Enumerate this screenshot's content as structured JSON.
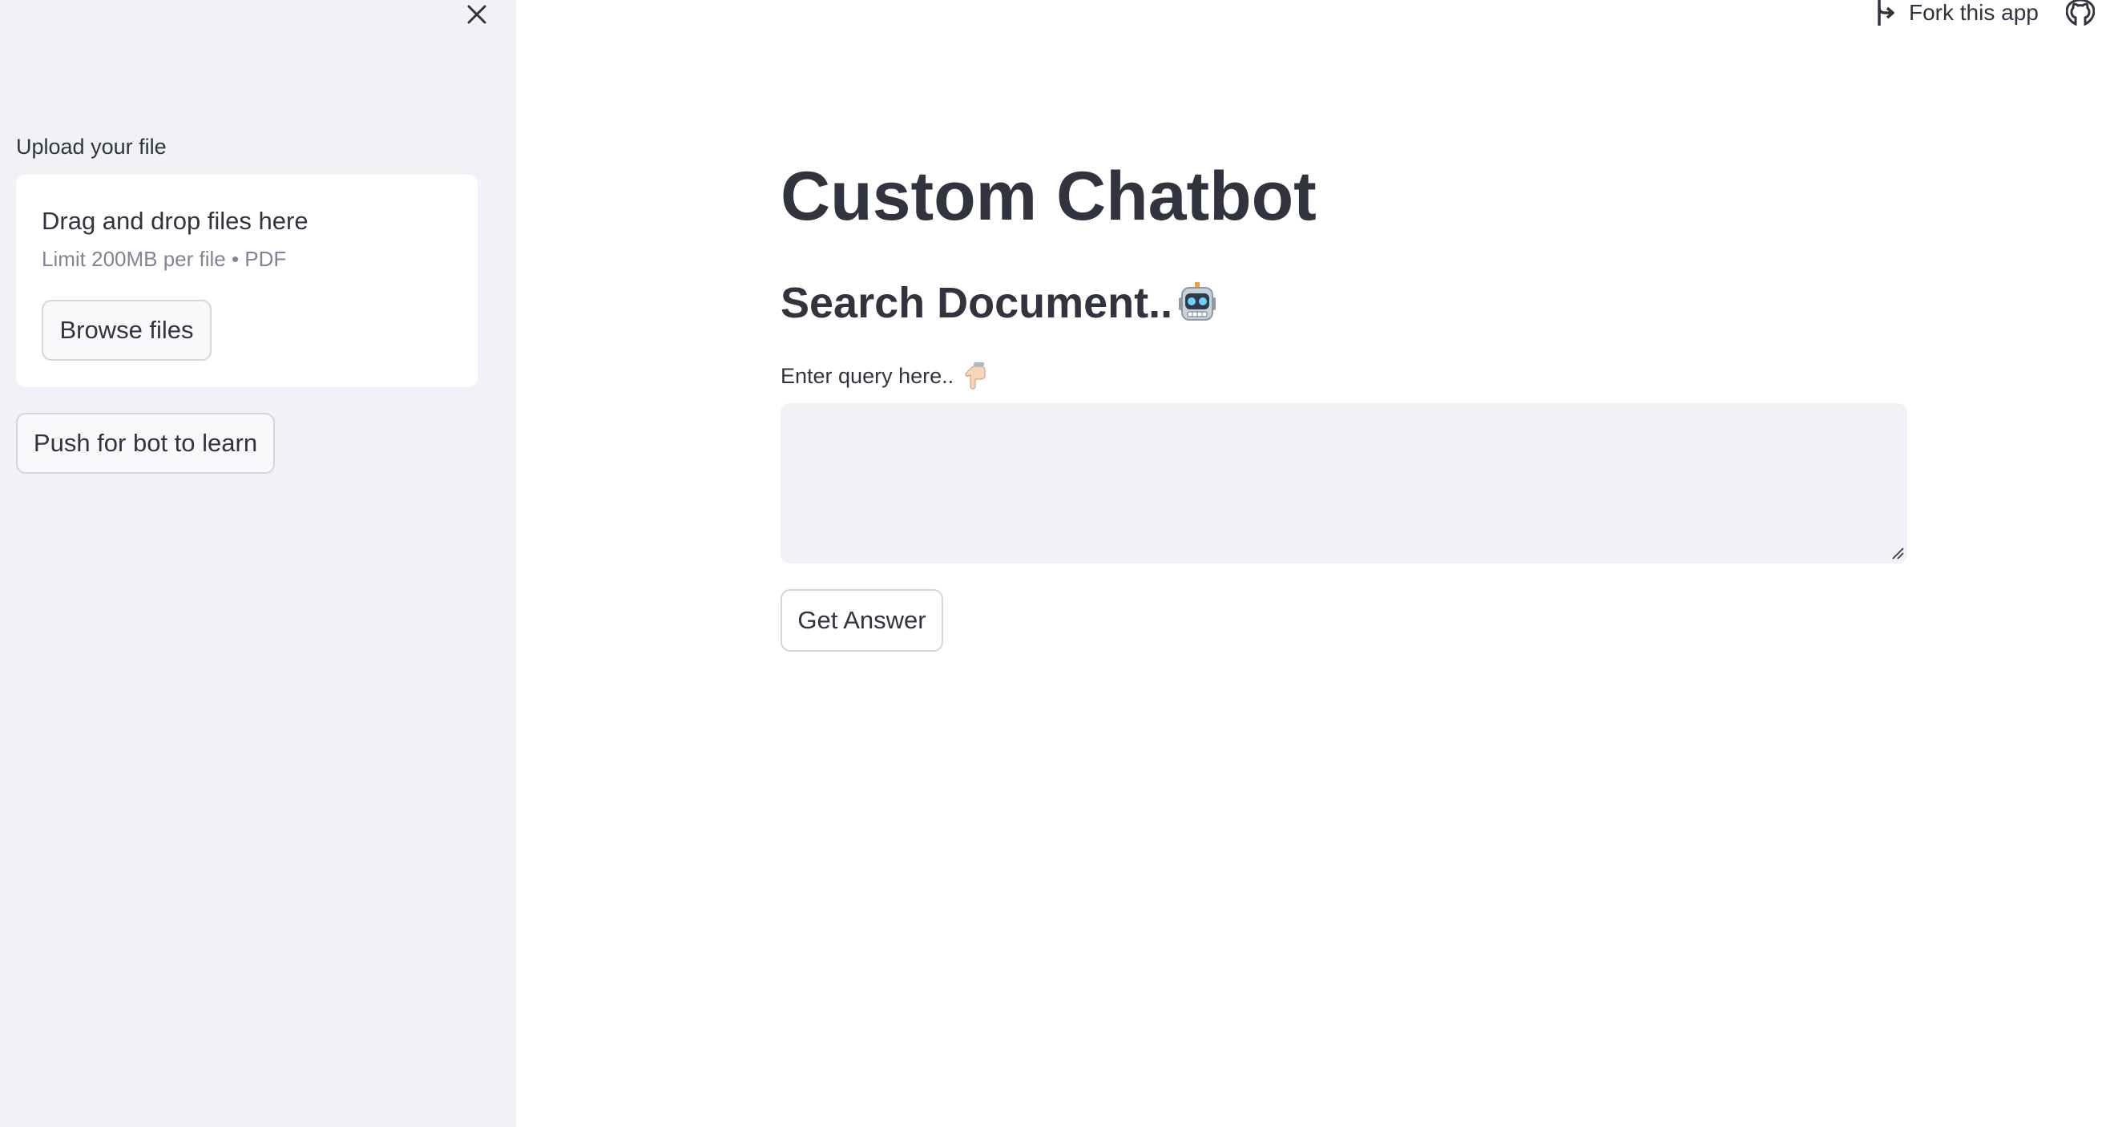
{
  "sidebar": {
    "upload_label": "Upload your file",
    "dropzone": {
      "title": "Drag and drop files here",
      "limit": "Limit 200MB per file • PDF",
      "browse_label": "Browse files"
    },
    "learn_button_label": "Push for bot to learn"
  },
  "header": {
    "fork_label": "Fork this app"
  },
  "main": {
    "title": "Custom Chatbot",
    "subtitle": "Search Document..",
    "query_label": "Enter query here..",
    "query_value": "",
    "answer_button_label": "Get Answer"
  },
  "icons": {
    "close": "close-icon",
    "fork": "fork-icon",
    "github": "github-icon",
    "robot": "robot-icon",
    "pointing_down": "pointing-down-icon"
  },
  "colors": {
    "sidebar_bg": "#f0f2f6",
    "text": "#31333f",
    "muted_text": "#808495",
    "input_bg": "#f0f2f6",
    "button_border": "#d3d6dc"
  }
}
